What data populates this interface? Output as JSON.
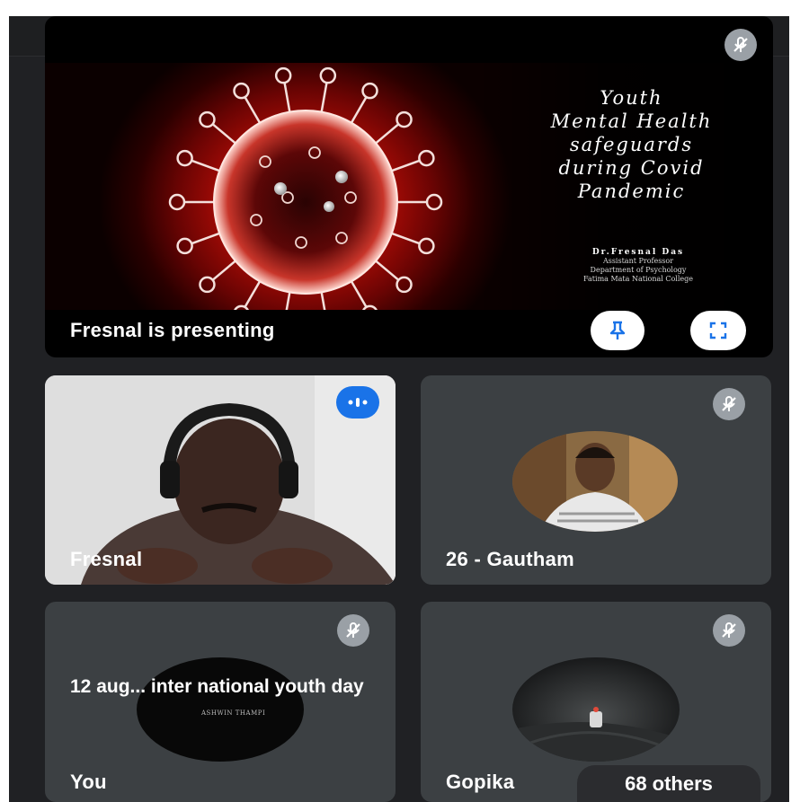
{
  "presentation": {
    "slide": {
      "title_lines": [
        "Youth",
        "Mental Health",
        "safeguards",
        "during Covid",
        "Pandemic"
      ],
      "author": "Dr.Fresnal Das",
      "designation": "Assistant Professor",
      "department": "Department of Psychology",
      "college": "Fatima Mata National College"
    },
    "caption": "Fresnal is presenting"
  },
  "participants": [
    {
      "name": "Fresnal",
      "speaking": true
    },
    {
      "name": "26 - Gautham",
      "muted": true
    },
    {
      "name": "You",
      "muted": true,
      "status": "12 aug... inter national youth day",
      "avatar_text": "ASHWIN THAMPI"
    },
    {
      "name": "Gopika",
      "muted": true
    }
  ],
  "others": {
    "label": "68 others"
  },
  "icons": {
    "mute": "mic-off-icon",
    "pin": "pin-icon",
    "fullscreen": "fullscreen-icon",
    "speaking": "audio-level-icon"
  },
  "colors": {
    "background": "#202124",
    "tile": "#3c4043",
    "accent_blue": "#1a73e8",
    "mute_badge": "#9aa0a6"
  }
}
